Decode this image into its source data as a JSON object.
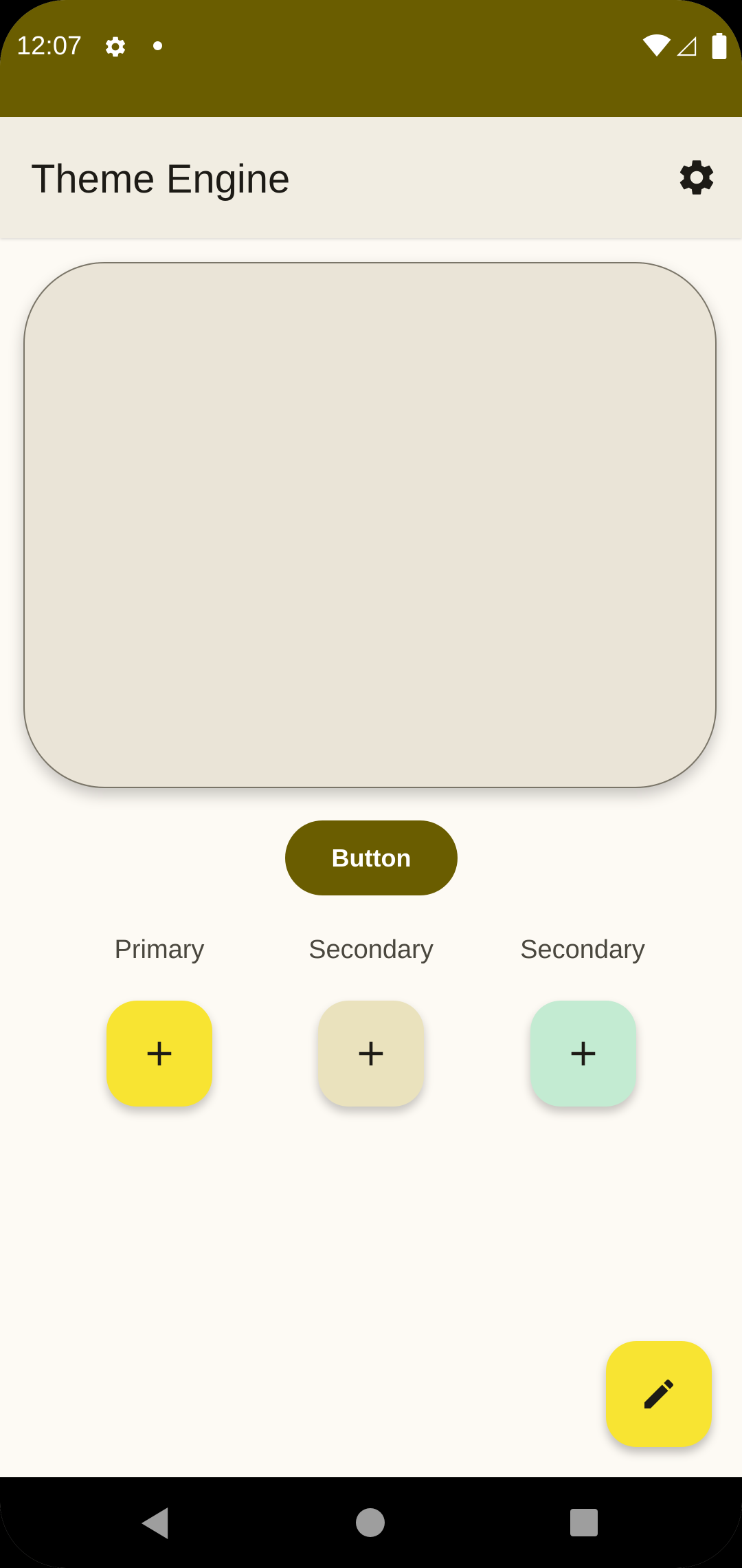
{
  "status_bar": {
    "time": "12:07",
    "icons": [
      "settings-icon",
      "notification-dot",
      "wifi-icon",
      "signal-icon",
      "battery-icon"
    ],
    "background": "#6A5D00"
  },
  "app_bar": {
    "title": "Theme Engine",
    "action_icon": "settings-icon",
    "background": "#F1EDE2"
  },
  "preview_card": {
    "background": "#EAE4D7",
    "border": "#7A7568"
  },
  "button": {
    "label": "Button",
    "background": "#6A5D00"
  },
  "fabs": [
    {
      "label": "Primary",
      "icon": "plus-icon",
      "color": "#F8E432"
    },
    {
      "label": "Secondary",
      "icon": "plus-icon",
      "color": "#EAE2BD"
    },
    {
      "label": "Secondary",
      "icon": "plus-icon",
      "color": "#C3EBD2"
    }
  ],
  "edit_fab": {
    "icon": "pencil-icon",
    "color": "#F8E432"
  },
  "nav_bar": {
    "icons": [
      "back-icon",
      "home-icon",
      "recents-icon"
    ]
  }
}
